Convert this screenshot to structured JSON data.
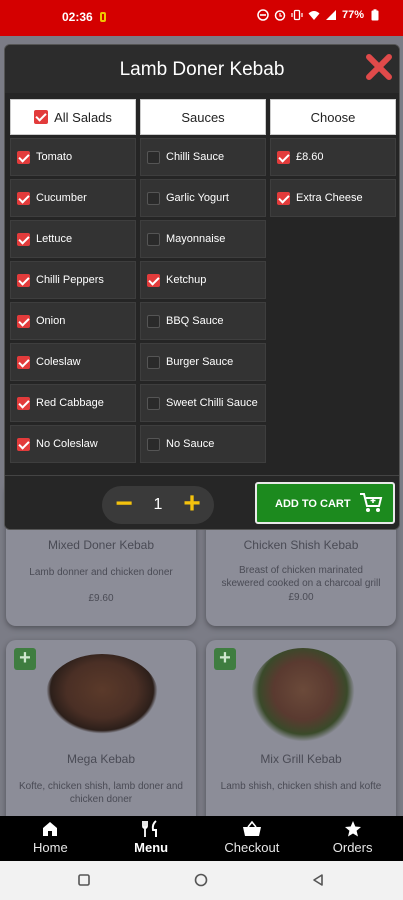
{
  "status": {
    "time": "02:36",
    "battery": "77%"
  },
  "modal": {
    "title": "Lamb Doner Kebab",
    "columns": {
      "salads": {
        "header": "All Salads",
        "items": [
          {
            "label": "Tomato",
            "checked": true
          },
          {
            "label": "Cucumber",
            "checked": true
          },
          {
            "label": "Lettuce",
            "checked": true
          },
          {
            "label": "Chilli Peppers",
            "checked": true
          },
          {
            "label": "Onion",
            "checked": true
          },
          {
            "label": "Coleslaw",
            "checked": true
          },
          {
            "label": "Red Cabbage",
            "checked": true
          },
          {
            "label": "No Coleslaw",
            "checked": true
          }
        ]
      },
      "sauces": {
        "header": "Sauces",
        "items": [
          {
            "label": "Chilli Sauce",
            "checked": false
          },
          {
            "label": "Garlic Yogurt",
            "checked": false
          },
          {
            "label": "Mayonnaise",
            "checked": false
          },
          {
            "label": "Ketchup",
            "checked": true
          },
          {
            "label": "BBQ Sauce",
            "checked": false
          },
          {
            "label": "Burger Sauce",
            "checked": false
          },
          {
            "label": "Sweet Chilli Sauce",
            "checked": false
          },
          {
            "label": "No Sauce",
            "checked": false
          }
        ]
      },
      "choose": {
        "header": "Choose",
        "items": [
          {
            "label": "£8.60",
            "checked": true
          },
          {
            "label": "Extra Cheese",
            "checked": true
          }
        ]
      }
    },
    "quantity": "1",
    "add_to_cart": "ADD TO CART"
  },
  "background_cards": [
    {
      "name": "Mixed Doner Kebab",
      "desc": "Lamb donner and chicken doner",
      "price": "£9.60"
    },
    {
      "name": "Chicken Shish Kebab",
      "desc": "Breast of chicken marinated skewered cooked on a charcoal grill",
      "price": "£9.00"
    },
    {
      "name": "Mega Kebab",
      "desc": "Kofte, chicken shish, lamb doner and chicken doner",
      "price": ""
    },
    {
      "name": "Mix Grill Kebab",
      "desc": "Lamb shish, chicken shish and kofte",
      "price": ""
    }
  ],
  "nav": {
    "items": [
      {
        "label": "Home",
        "icon": "home-icon"
      },
      {
        "label": "Menu",
        "icon": "fork-knife-icon"
      },
      {
        "label": "Checkout",
        "icon": "basket-icon"
      },
      {
        "label": "Orders",
        "icon": "star-icon"
      }
    ],
    "active": "Menu"
  },
  "colors": {
    "accent_red": "#e23b3b",
    "status_red": "#d40000",
    "cart_green": "#1c8a1e",
    "qty_yellow": "#f4c20d"
  }
}
